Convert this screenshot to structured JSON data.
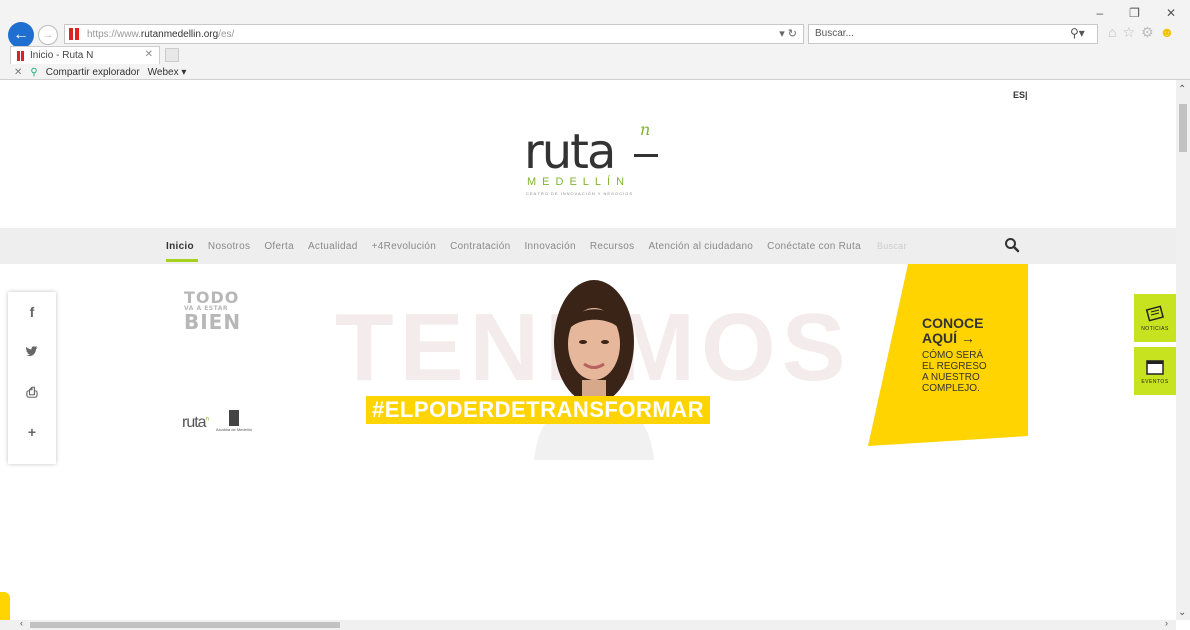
{
  "browser": {
    "url_prefix": "https://www.",
    "url_domain": "rutanmedellin.org",
    "url_suffix": "/es/",
    "search_placeholder": "Buscar...",
    "tab_title": "Inicio - Ruta N",
    "favbar": {
      "share_label": "Compartir explorador",
      "webex_label": "Webex ▾"
    }
  },
  "page": {
    "lang": "ES|",
    "logo": {
      "word": "ruta",
      "sup": "n",
      "city": "MEDELLÍN",
      "tagline": "CENTRO DE INNOVACIÓN Y NEGOCIOS"
    },
    "nav": {
      "items": [
        {
          "label": "Inicio"
        },
        {
          "label": "Nosotros"
        },
        {
          "label": "Oferta"
        },
        {
          "label": "Actualidad"
        },
        {
          "label": "+4Revolución"
        },
        {
          "label": "Contratación"
        },
        {
          "label": "Innovación"
        },
        {
          "label": "Recursos"
        },
        {
          "label": "Atención al ciudadano"
        },
        {
          "label": "Conéctate con Ruta"
        }
      ],
      "search_placeholder": "Buscar"
    },
    "banner": {
      "todo_l1": "TODO",
      "todo_l2": "VA A ESTAR",
      "todo_l3": "BIEN",
      "bg_word": "TENEMOS",
      "hashtag": "#ELPODERDETRANSFORMAR",
      "small_logo": "ruta",
      "small_logo_sup": "n",
      "alcaldia": "Alcaldía de Medellín",
      "promo_title_1": "CONOCE",
      "promo_title_2": "AQUÍ →",
      "promo_sub_1": "CÓMO SERÁ",
      "promo_sub_2": "EL REGRESO",
      "promo_sub_3": "A NUESTRO",
      "promo_sub_4": "COMPLEJO."
    },
    "side_tabs": {
      "news": "NOTICIAS",
      "events": "EVENTOS"
    },
    "share_icons": [
      "facebook-icon",
      "twitter-icon",
      "print-icon",
      "plus-icon"
    ]
  },
  "colors": {
    "accent_green": "#a6d21f",
    "lime": "#c7e320",
    "yellow": "#ffd400",
    "brand_green": "#7fb52e"
  }
}
